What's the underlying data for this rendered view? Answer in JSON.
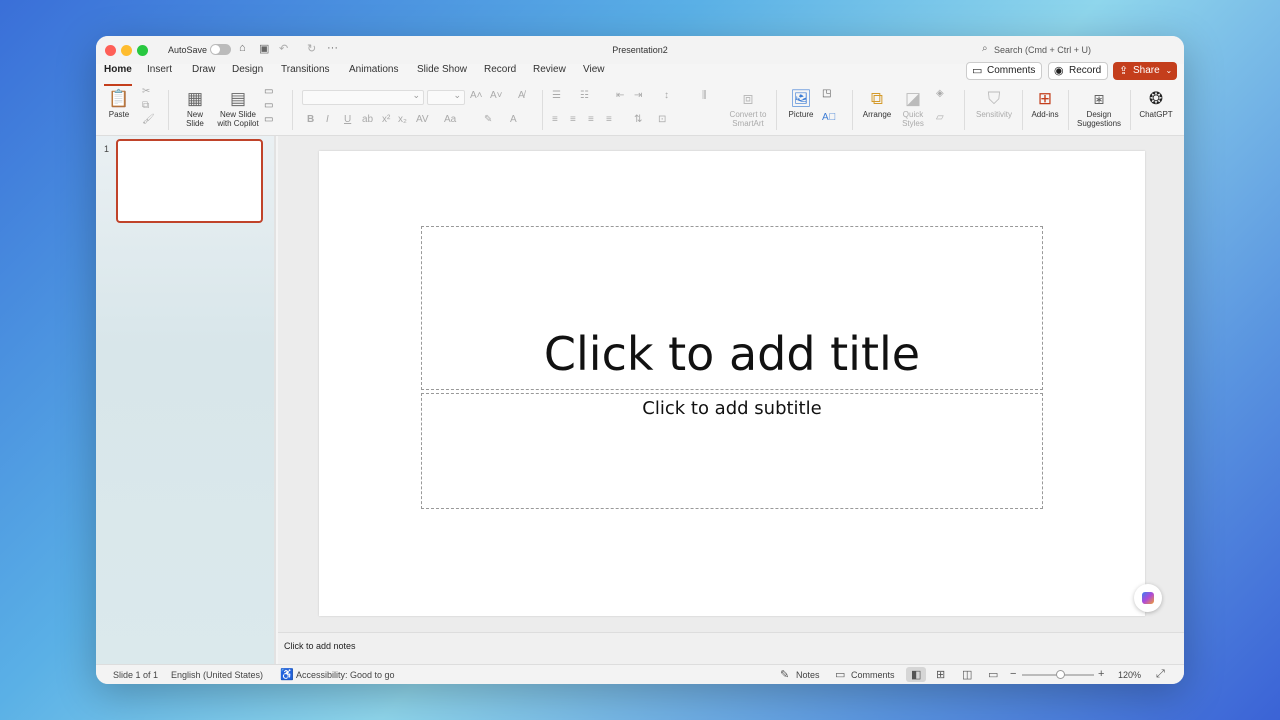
{
  "titlebar": {
    "autosave_label": "AutoSave",
    "document_title": "Presentation2",
    "search_placeholder": "Search (Cmd + Ctrl + U)"
  },
  "tabs": [
    "Home",
    "Insert",
    "Draw",
    "Design",
    "Transitions",
    "Animations",
    "Slide Show",
    "Record",
    "Review",
    "View"
  ],
  "active_tab": "Home",
  "header_buttons": {
    "comments": "Comments",
    "record": "Record",
    "share": "Share"
  },
  "ribbon": {
    "paste": "Paste",
    "new_slide_1": "New",
    "new_slide_2": "Slide",
    "new_slide_copilot_1": "New Slide",
    "new_slide_copilot_2": "with Copilot",
    "convert_smartart_1": "Convert to",
    "convert_smartart_2": "SmartArt",
    "picture": "Picture",
    "arrange": "Arrange",
    "quick_styles_1": "Quick",
    "quick_styles_2": "Styles",
    "sensitivity": "Sensitivity",
    "add_ins": "Add-ins",
    "design_suggestions_1": "Design",
    "design_suggestions_2": "Suggestions",
    "chatgpt": "ChatGPT",
    "font_bold": "B",
    "font_italic": "I",
    "font_underline": "U"
  },
  "thumbnails": {
    "slide_number": "1"
  },
  "slide": {
    "title_placeholder": "Click to add title",
    "subtitle_placeholder": "Click to add subtitle"
  },
  "notes": {
    "placeholder": "Click to add notes"
  },
  "status": {
    "slide_count": "Slide 1 of 1",
    "language": "English (United States)",
    "accessibility": "Accessibility: Good to go",
    "notes": "Notes",
    "comments": "Comments",
    "zoom": "120%"
  },
  "colors": {
    "accent": "#c43e1c",
    "share_bg": "#c43e1c"
  }
}
